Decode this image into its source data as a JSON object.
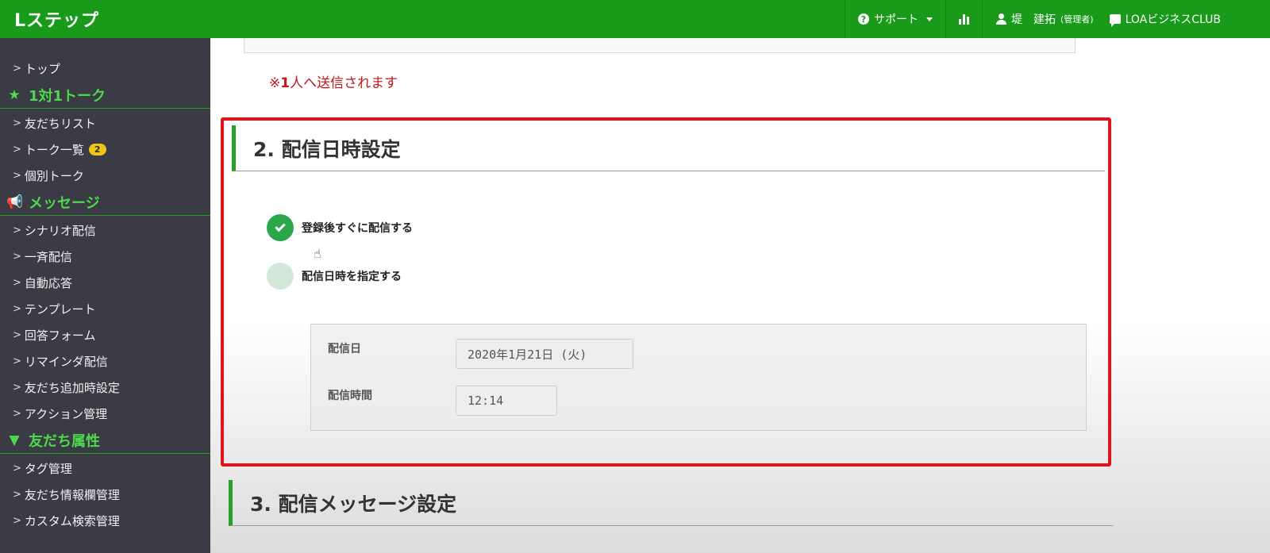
{
  "app": {
    "brand": "Lステップ"
  },
  "topnav": {
    "support": "サポート",
    "user_name": "堤　建拓",
    "user_role": "(管理者)",
    "club": "LOAビジネスCLUB",
    "icons": [
      "question-icon",
      "bar-chart-icon",
      "user-icon",
      "chat-icon"
    ]
  },
  "sidebar": {
    "top": "トップ",
    "sections": [
      {
        "title": "1対1トーク",
        "icon": "star-icon",
        "items": [
          "友だちリスト",
          "トーク一覧",
          "個別トーク"
        ]
      },
      {
        "title": "メッセージ",
        "icon": "megaphone-icon",
        "items": [
          "シナリオ配信",
          "一斉配信",
          "自動応答",
          "テンプレート",
          "回答フォーム",
          "リマインダ配信",
          "友だち追加時設定",
          "アクション管理"
        ]
      },
      {
        "title": "友だち属性",
        "icon": "filter-icon",
        "items": [
          "タグ管理",
          "友だち情報欄管理",
          "カスタム検索管理"
        ]
      }
    ],
    "talk_badge": "2"
  },
  "main": {
    "notice_prefix": "※",
    "notice_bold": "1",
    "notice_rest": "人へ送信されます",
    "section2_title": "2. 配信日時設定",
    "option_immediate": "登録後すぐに配信する",
    "option_schedule": "配信日時を指定する",
    "selected_option": "immediate",
    "date_label": "配信日",
    "date_value": "2020年1月21日 (火)",
    "time_label": "配信時間",
    "time_value": "12:14",
    "section3_title": "3. 配信メッセージ設定"
  },
  "colors": {
    "topbar": "#1a9a1a",
    "sidebar": "#3a3b44",
    "sidebar_heading": "#4cd94c",
    "accent_red": "#e0151b",
    "radio_on": "#2aa74a"
  }
}
